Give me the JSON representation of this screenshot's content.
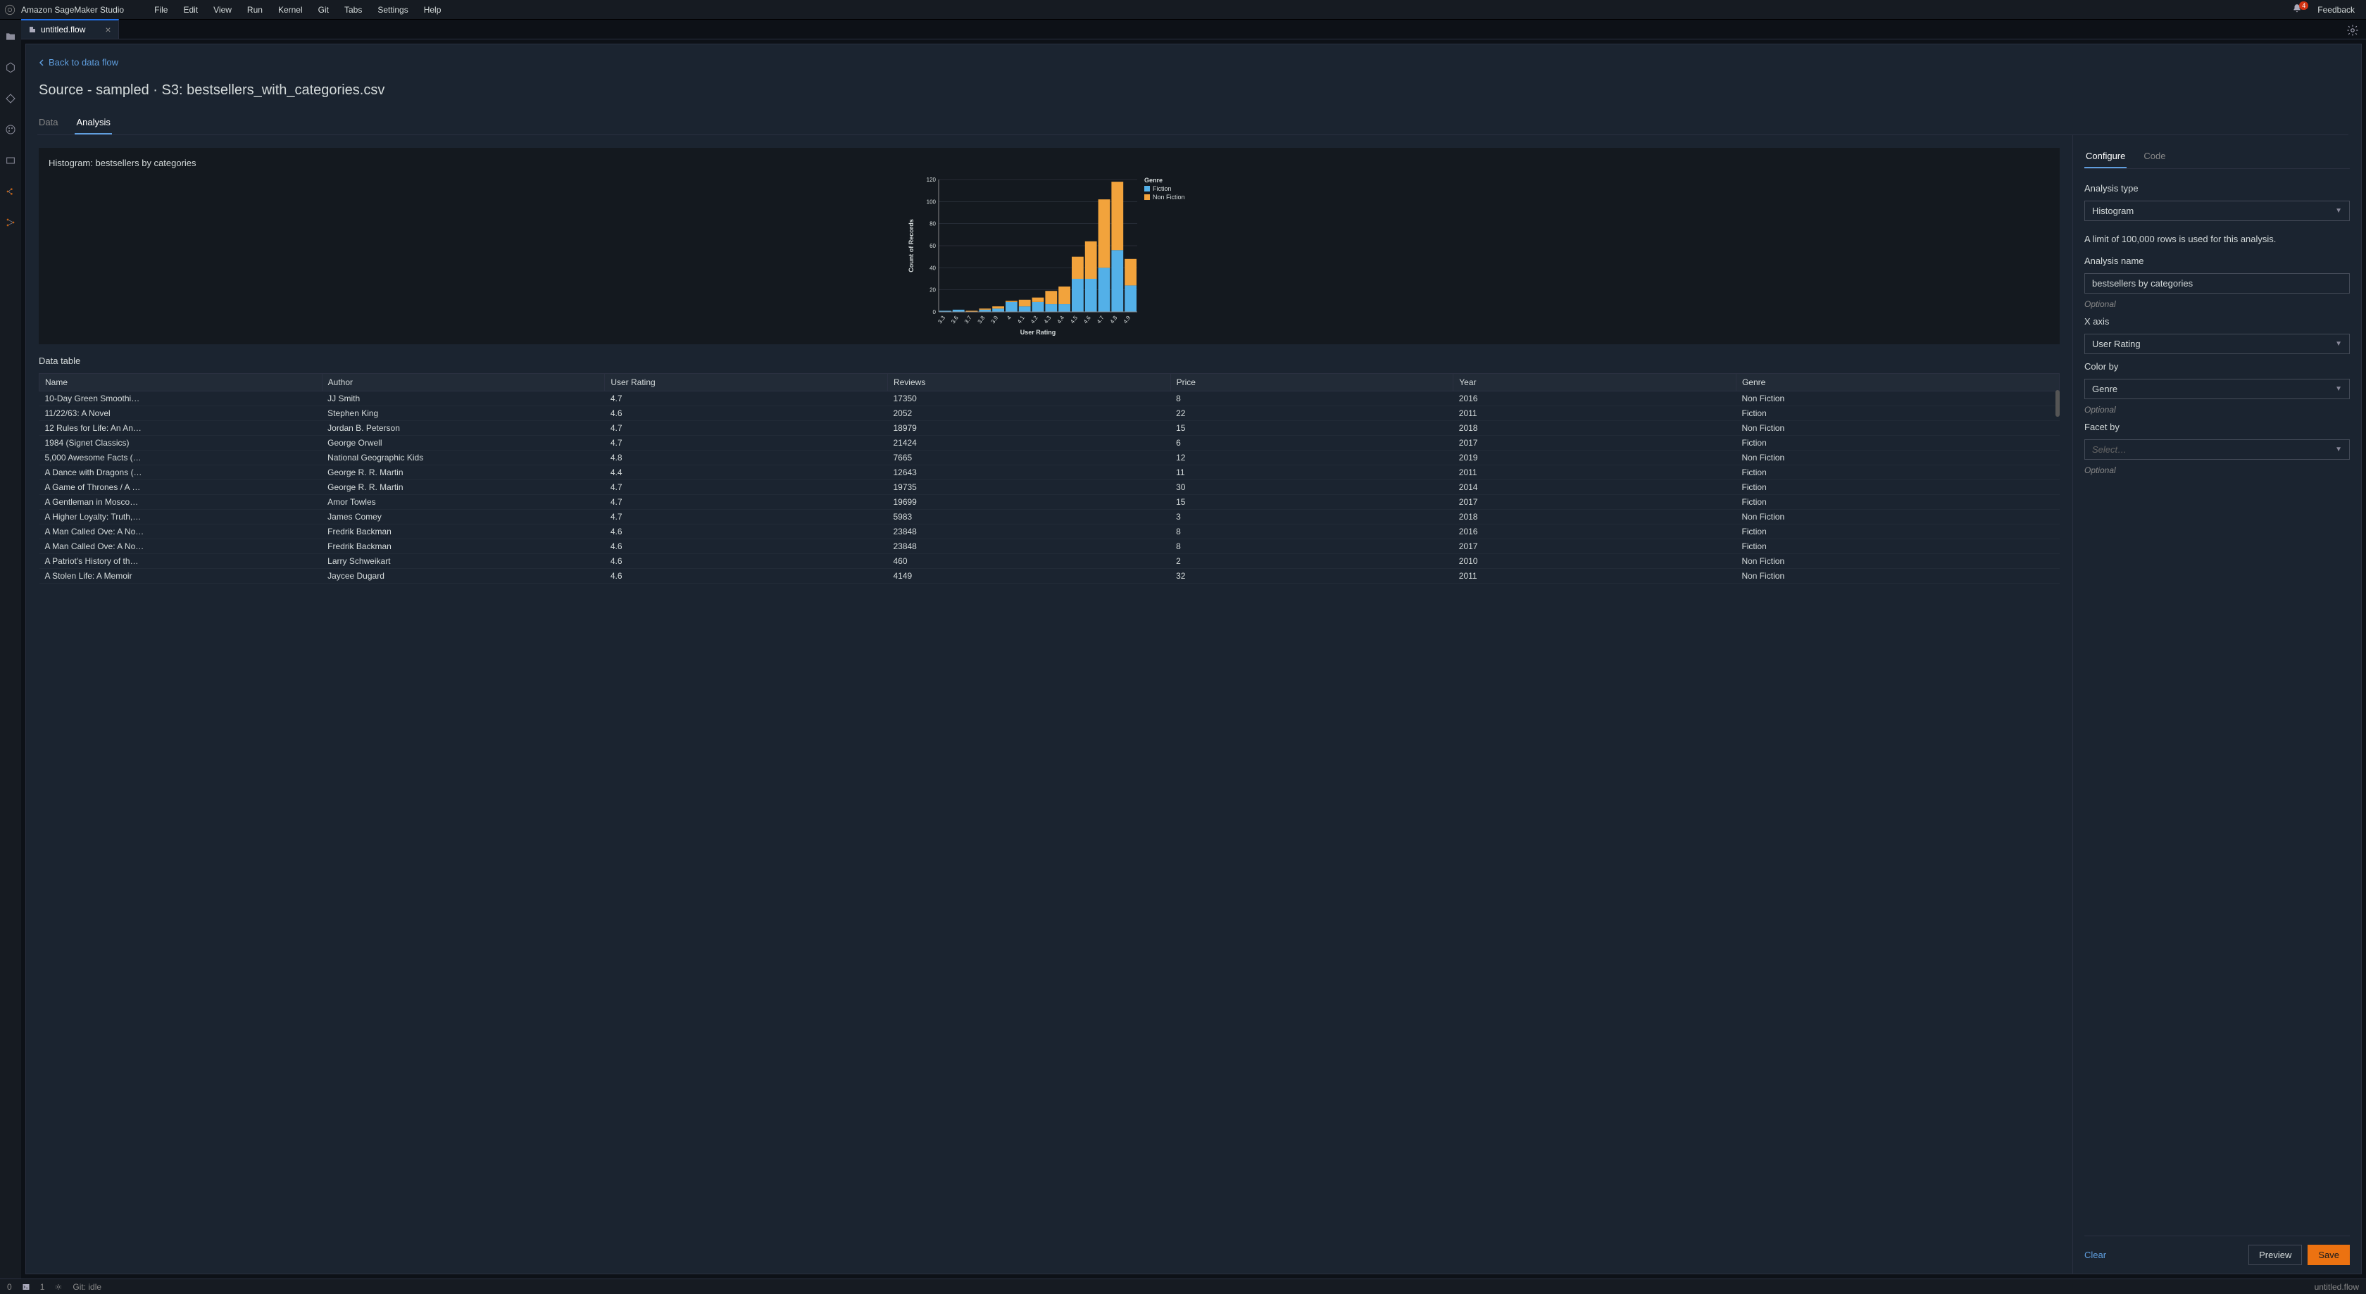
{
  "menubar": {
    "brand": "Amazon SageMaker Studio",
    "items": [
      "File",
      "Edit",
      "View",
      "Run",
      "Kernel",
      "Git",
      "Tabs",
      "Settings",
      "Help"
    ],
    "notification_count": "4",
    "feedback": "Feedback"
  },
  "tab": {
    "name": "untitled.flow"
  },
  "back_link": "Back to data flow",
  "page_title": "Source - sampled · S3: bestsellers_with_categories.csv",
  "subtabs": {
    "data": "Data",
    "analysis": "Analysis"
  },
  "chart": {
    "title": "Histogram: bestsellers by categories"
  },
  "chart_data": {
    "type": "bar",
    "stacked": true,
    "xlabel": "User Rating",
    "ylabel": "Count of Records",
    "ylim": [
      0,
      120
    ],
    "yticks": [
      0,
      20,
      40,
      60,
      80,
      100,
      120
    ],
    "categories": [
      "3.3",
      "3.6",
      "3.7",
      "3.8",
      "3.9",
      "4",
      "4.1",
      "4.2",
      "4.3",
      "4.4",
      "4.5",
      "4.6",
      "4.7",
      "4.8",
      "4.9"
    ],
    "legend_title": "Genre",
    "series": [
      {
        "name": "Fiction",
        "color": "#53b0e8",
        "values": [
          1,
          2,
          0,
          2,
          3,
          9,
          5,
          9,
          7,
          7,
          30,
          30,
          40,
          56,
          24
        ]
      },
      {
        "name": "Non Fiction",
        "color": "#f2a33c",
        "values": [
          0,
          0,
          1,
          1,
          2,
          1,
          6,
          4,
          12,
          16,
          20,
          34,
          62,
          62,
          24
        ]
      }
    ]
  },
  "data_table": {
    "title": "Data table",
    "columns": [
      "Name",
      "Author",
      "User Rating",
      "Reviews",
      "Price",
      "Year",
      "Genre"
    ],
    "rows": [
      [
        "10-Day Green Smoothi…",
        "JJ Smith",
        "4.7",
        "17350",
        "8",
        "2016",
        "Non Fiction"
      ],
      [
        "11/22/63: A Novel",
        "Stephen King",
        "4.6",
        "2052",
        "22",
        "2011",
        "Fiction"
      ],
      [
        "12 Rules for Life: An An…",
        "Jordan B. Peterson",
        "4.7",
        "18979",
        "15",
        "2018",
        "Non Fiction"
      ],
      [
        "1984 (Signet Classics)",
        "George Orwell",
        "4.7",
        "21424",
        "6",
        "2017",
        "Fiction"
      ],
      [
        "5,000 Awesome Facts (…",
        "National Geographic Kids",
        "4.8",
        "7665",
        "12",
        "2019",
        "Non Fiction"
      ],
      [
        "A Dance with Dragons (…",
        "George R. R. Martin",
        "4.4",
        "12643",
        "11",
        "2011",
        "Fiction"
      ],
      [
        "A Game of Thrones / A …",
        "George R. R. Martin",
        "4.7",
        "19735",
        "30",
        "2014",
        "Fiction"
      ],
      [
        "A Gentleman in Mosco…",
        "Amor Towles",
        "4.7",
        "19699",
        "15",
        "2017",
        "Fiction"
      ],
      [
        "A Higher Loyalty: Truth,…",
        "James Comey",
        "4.7",
        "5983",
        "3",
        "2018",
        "Non Fiction"
      ],
      [
        "A Man Called Ove: A No…",
        "Fredrik Backman",
        "4.6",
        "23848",
        "8",
        "2016",
        "Fiction"
      ],
      [
        "A Man Called Ove: A No…",
        "Fredrik Backman",
        "4.6",
        "23848",
        "8",
        "2017",
        "Fiction"
      ],
      [
        "A Patriot's History of th…",
        "Larry Schweikart",
        "4.6",
        "460",
        "2",
        "2010",
        "Non Fiction"
      ],
      [
        "A Stolen Life: A Memoir",
        "Jaycee Dugard",
        "4.6",
        "4149",
        "32",
        "2011",
        "Non Fiction"
      ]
    ]
  },
  "config": {
    "tabs": {
      "configure": "Configure",
      "code": "Code"
    },
    "analysis_type_label": "Analysis type",
    "analysis_type_value": "Histogram",
    "limit_note": "A limit of 100,000 rows is used for this analysis.",
    "analysis_name_label": "Analysis name",
    "analysis_name_value": "bestsellers by categories",
    "optional": "Optional",
    "xaxis_label": "X axis",
    "xaxis_value": "User Rating",
    "colorby_label": "Color by",
    "colorby_value": "Genre",
    "facetby_label": "Facet by",
    "facetby_placeholder": "Select…",
    "clear": "Clear",
    "preview": "Preview",
    "save": "Save"
  },
  "statusbar": {
    "zero": "0",
    "one": "1",
    "git": "Git: idle",
    "right": "untitled.flow"
  }
}
